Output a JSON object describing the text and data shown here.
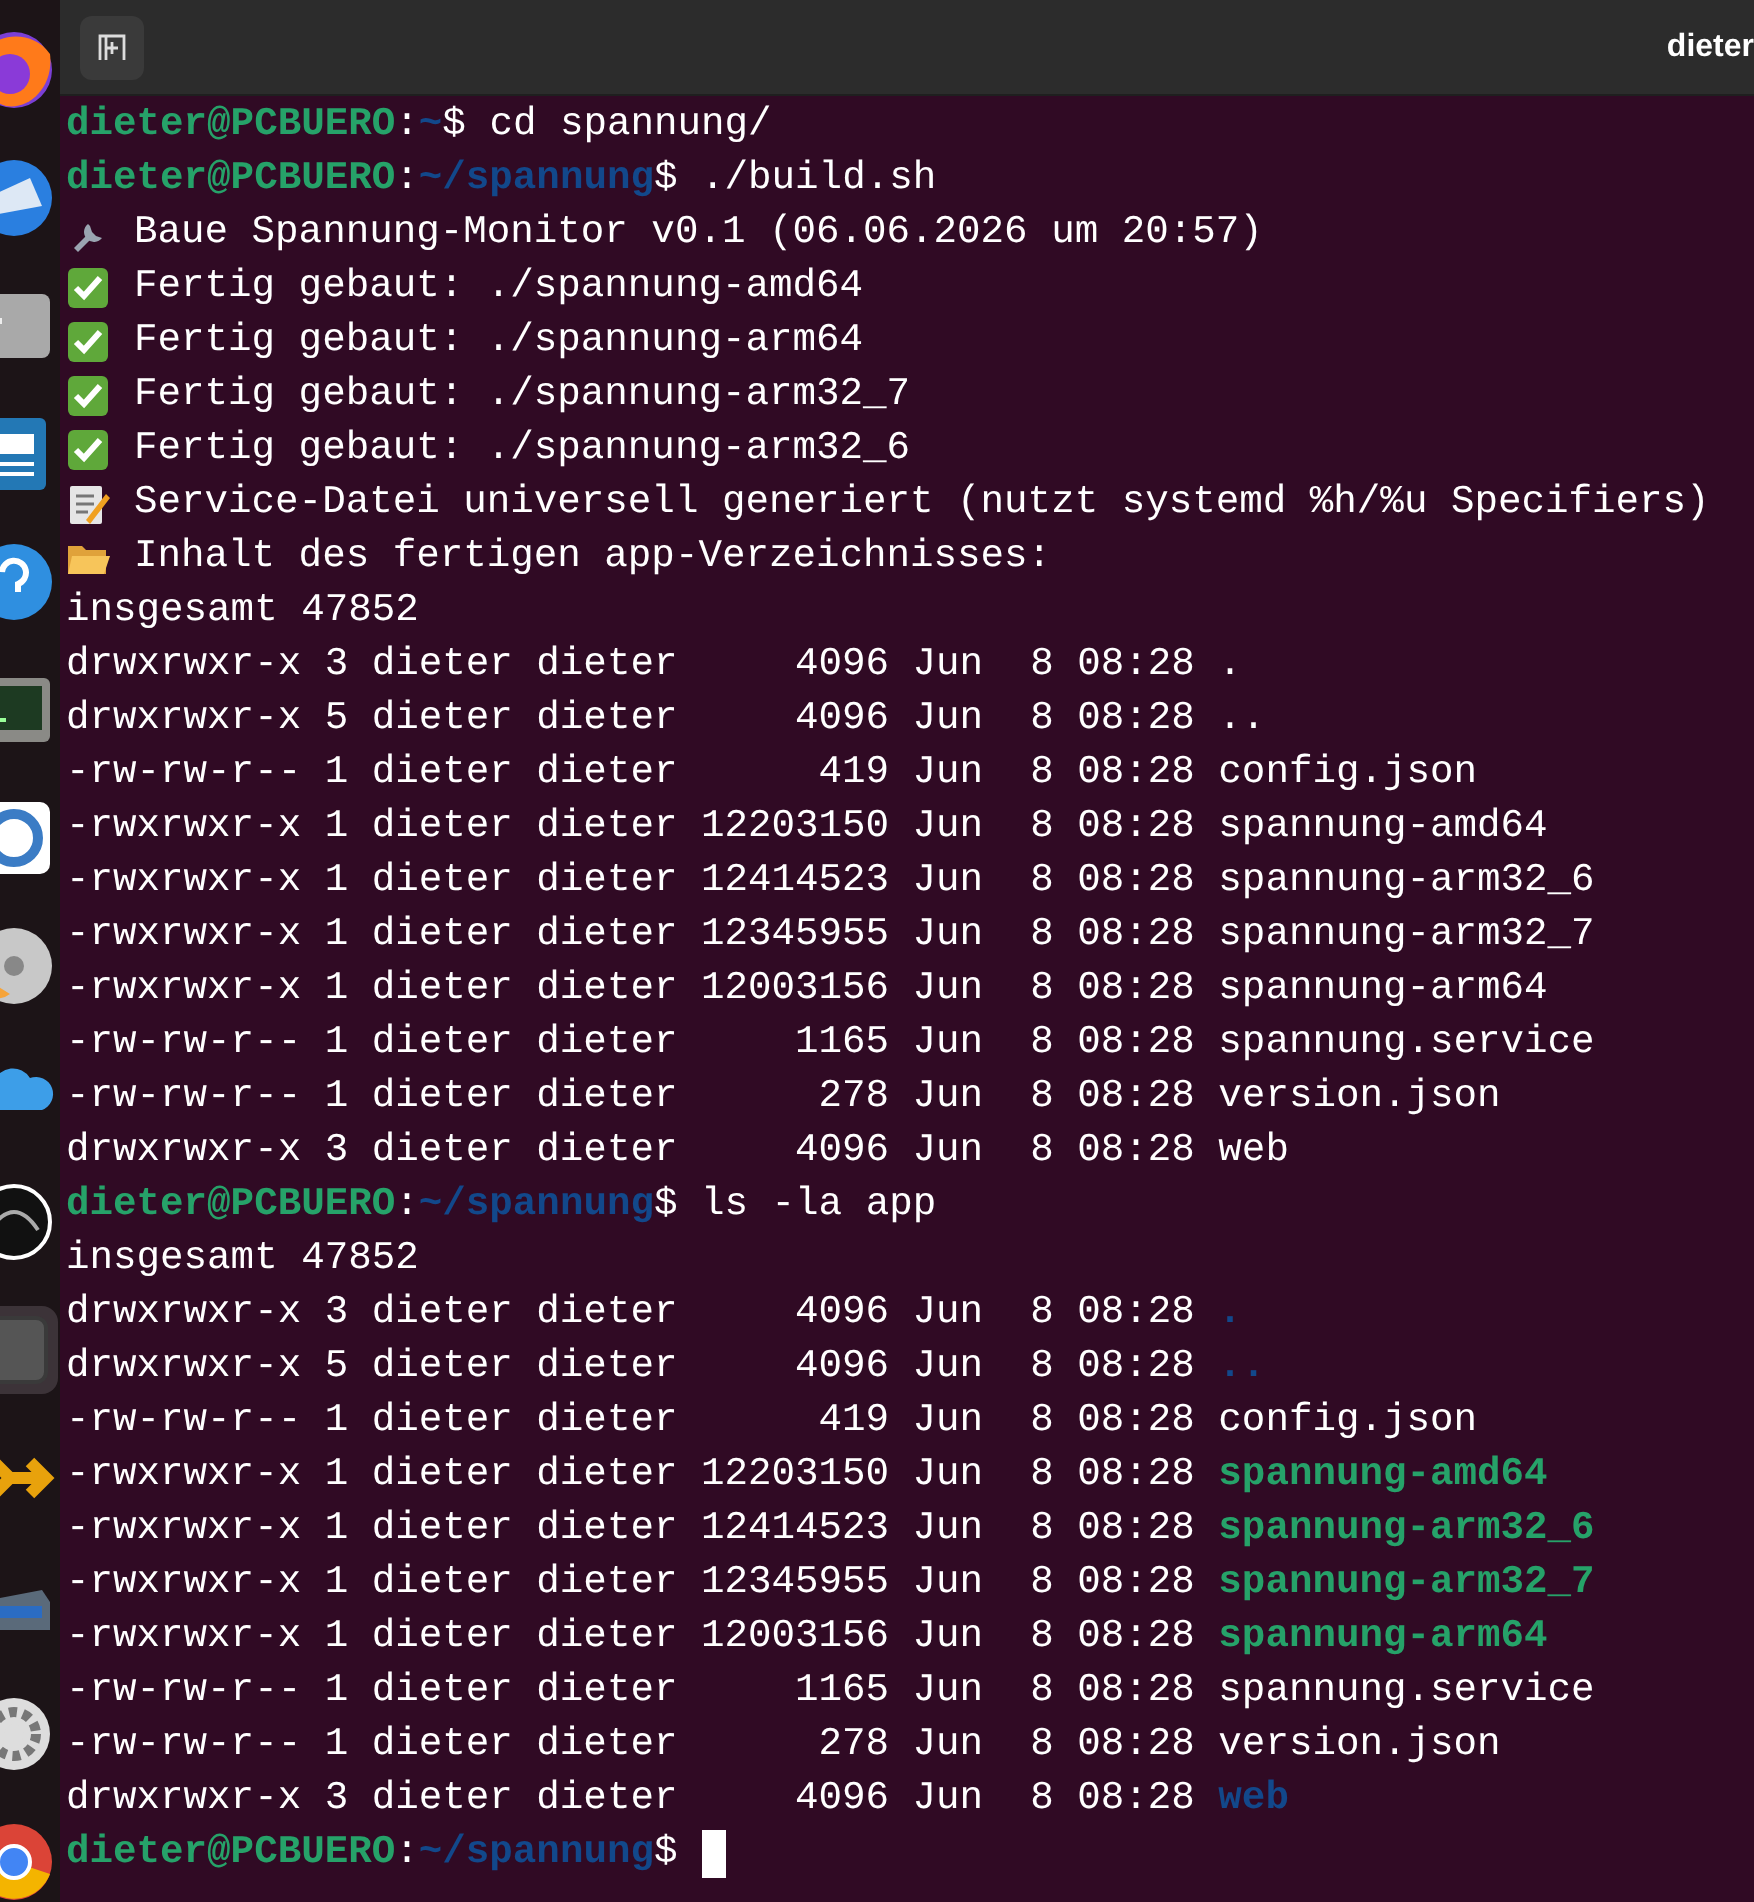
{
  "dock": {
    "items": [
      {
        "kind": "flame",
        "selected": false
      },
      {
        "kind": "bird",
        "selected": false
      },
      {
        "kind": "drawer",
        "selected": false
      },
      {
        "kind": "document",
        "selected": false
      },
      {
        "kind": "help",
        "selected": false
      },
      {
        "kind": "monitor",
        "selected": false
      },
      {
        "kind": "ring",
        "selected": false
      },
      {
        "kind": "disc",
        "selected": false
      },
      {
        "kind": "cloud",
        "selected": false
      },
      {
        "kind": "orb",
        "selected": false
      },
      {
        "kind": "window",
        "selected": true
      },
      {
        "kind": "arrows",
        "selected": false
      },
      {
        "kind": "scanner",
        "selected": false
      },
      {
        "kind": "gear",
        "selected": false
      },
      {
        "kind": "wheel",
        "selected": false
      }
    ]
  },
  "header": {
    "title": "dieter"
  },
  "terminal": {
    "lines": [
      {
        "kind": "prompt",
        "user": "dieter@PCBUERO",
        "separator": ":",
        "path": "~",
        "symbol": "$",
        "command": "cd spannung/"
      },
      {
        "kind": "prompt",
        "user": "dieter@PCBUERO",
        "separator": ":",
        "path": "~/spannung",
        "symbol": "$",
        "command": "./build.sh"
      },
      {
        "kind": "build_start",
        "text": "Baue Spannung-Monitor v0.1 (06.06.2026 um 20:57)"
      },
      {
        "kind": "build_done",
        "text": "Fertig gebaut: ./spannung-amd64"
      },
      {
        "kind": "build_done",
        "text": "Fertig gebaut: ./spannung-arm64"
      },
      {
        "kind": "build_done",
        "text": "Fertig gebaut: ./spannung-arm32_7"
      },
      {
        "kind": "build_done",
        "text": "Fertig gebaut: ./spannung-arm32_6"
      },
      {
        "kind": "note",
        "text": "Service-Datei universell generiert (nutzt systemd %h/%u Specifiers)"
      },
      {
        "kind": "folder_note",
        "text": "Inhalt des fertigen app-Verzeichnisses:"
      },
      {
        "kind": "output",
        "text": "insgesamt 47852"
      },
      {
        "kind": "listing",
        "meta": "drwxrwxr-x 3 dieter dieter     4096 Jun  8 08:28",
        "name": "."
      },
      {
        "kind": "listing",
        "meta": "drwxrwxr-x 5 dieter dieter     4096 Jun  8 08:28",
        "name": ".."
      },
      {
        "kind": "listing",
        "meta": "-rw-rw-r-- 1 dieter dieter      419 Jun  8 08:28",
        "name": "config.json"
      },
      {
        "kind": "listing",
        "meta": "-rwxrwxr-x 1 dieter dieter 12203150 Jun  8 08:28",
        "name": "spannung-amd64"
      },
      {
        "kind": "listing",
        "meta": "-rwxrwxr-x 1 dieter dieter 12414523 Jun  8 08:28",
        "name": "spannung-arm32_6"
      },
      {
        "kind": "listing",
        "meta": "-rwxrwxr-x 1 dieter dieter 12345955 Jun  8 08:28",
        "name": "spannung-arm32_7"
      },
      {
        "kind": "listing",
        "meta": "-rwxrwxr-x 1 dieter dieter 12003156 Jun  8 08:28",
        "name": "spannung-arm64"
      },
      {
        "kind": "listing",
        "meta": "-rw-rw-r-- 1 dieter dieter     1165 Jun  8 08:28",
        "name": "spannung.service"
      },
      {
        "kind": "listing",
        "meta": "-rw-rw-r-- 1 dieter dieter      278 Jun  8 08:28",
        "name": "version.json"
      },
      {
        "kind": "listing",
        "meta": "drwxrwxr-x 3 dieter dieter     4096 Jun  8 08:28",
        "name": "web"
      },
      {
        "kind": "prompt",
        "user": "dieter@PCBUERO",
        "separator": ":",
        "path": "~/spannung",
        "symbol": "$",
        "command": "ls -la app"
      },
      {
        "kind": "output",
        "text": "insgesamt 47852"
      },
      {
        "kind": "listing_dir",
        "meta": "drwxrwxr-x 3 dieter dieter     4096 Jun  8 08:28",
        "name": "."
      },
      {
        "kind": "listing_dir",
        "meta": "drwxrwxr-x 5 dieter dieter     4096 Jun  8 08:28",
        "name": ".."
      },
      {
        "kind": "listing",
        "meta": "-rw-rw-r-- 1 dieter dieter      419 Jun  8 08:28",
        "name": "config.json"
      },
      {
        "kind": "listing_exec",
        "meta": "-rwxrwxr-x 1 dieter dieter 12203150 Jun  8 08:28",
        "name": "spannung-amd64"
      },
      {
        "kind": "listing_exec",
        "meta": "-rwxrwxr-x 1 dieter dieter 12414523 Jun  8 08:28",
        "name": "spannung-arm32_6"
      },
      {
        "kind": "listing_exec",
        "meta": "-rwxrwxr-x 1 dieter dieter 12345955 Jun  8 08:28",
        "name": "spannung-arm32_7"
      },
      {
        "kind": "listing_exec",
        "meta": "-rwxrwxr-x 1 dieter dieter 12003156 Jun  8 08:28",
        "name": "spannung-arm64"
      },
      {
        "kind": "listing",
        "meta": "-rw-rw-r-- 1 dieter dieter     1165 Jun  8 08:28",
        "name": "spannung.service"
      },
      {
        "kind": "listing",
        "meta": "-rw-rw-r-- 1 dieter dieter      278 Jun  8 08:28",
        "name": "version.json"
      },
      {
        "kind": "listing_dir",
        "meta": "drwxrwxr-x 3 dieter dieter     4096 Jun  8 08:28",
        "name": "web"
      },
      {
        "kind": "prompt",
        "user": "dieter@PCBUERO",
        "separator": ":",
        "path": "~/spannung",
        "symbol": "$",
        "cursor": true
      }
    ]
  }
}
